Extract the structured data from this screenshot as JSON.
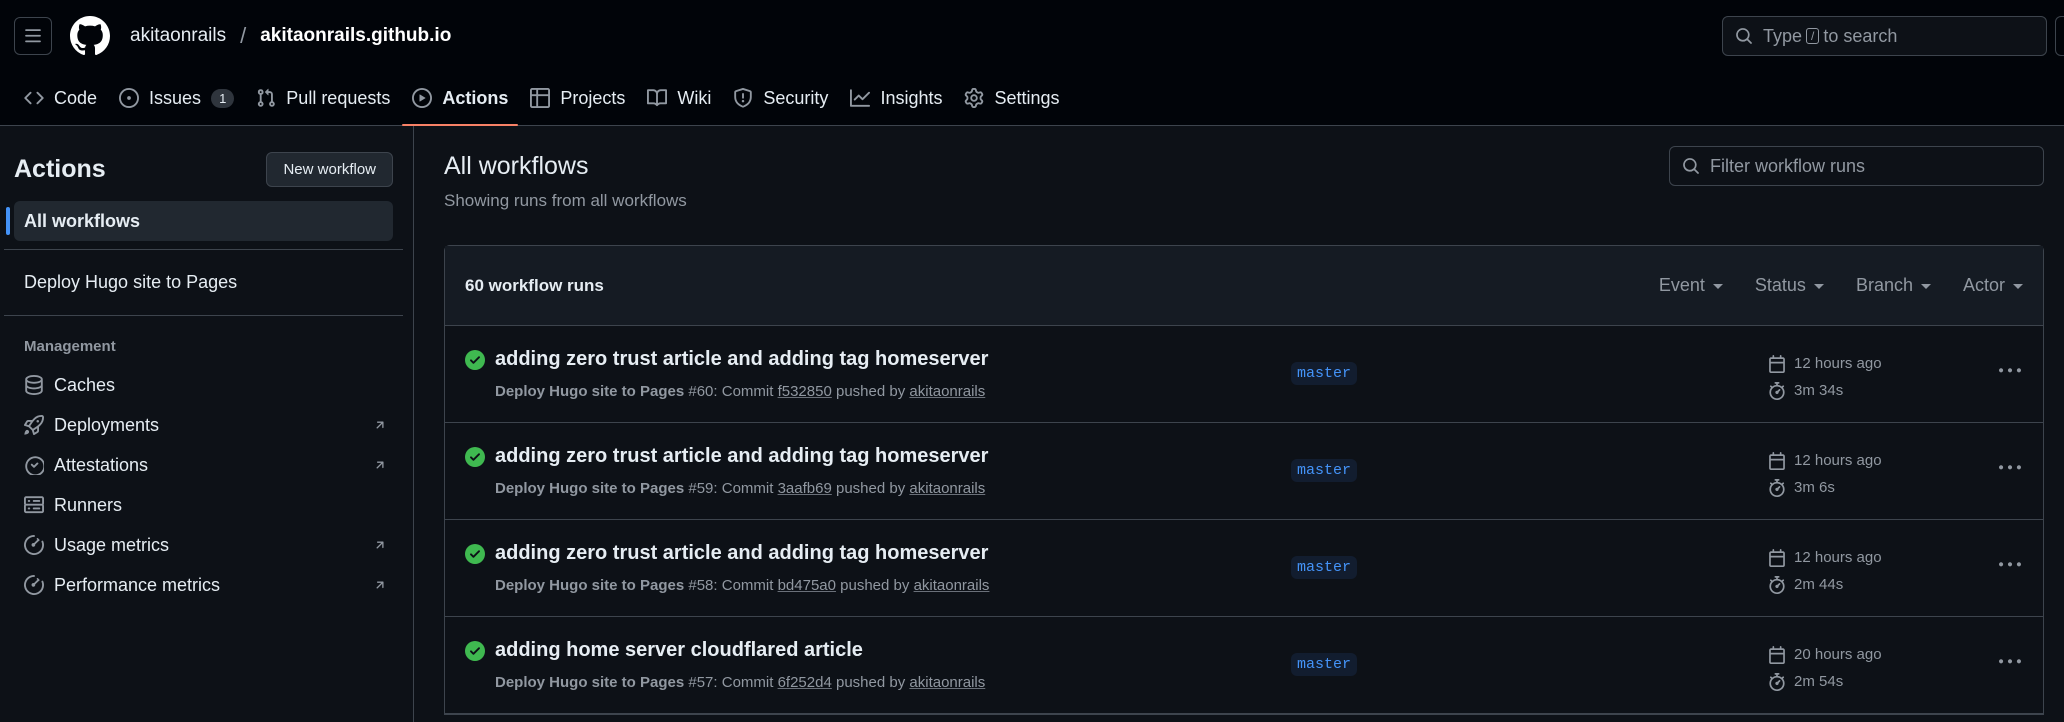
{
  "header": {
    "owner": "akitaonrails",
    "separator": "/",
    "repo": "akitaonrails.github.io",
    "search_prefix": "Type",
    "search_key": "/",
    "search_suffix": "to search"
  },
  "nav": {
    "code": "Code",
    "issues": "Issues",
    "issues_count": "1",
    "pulls": "Pull requests",
    "actions": "Actions",
    "projects": "Projects",
    "wiki": "Wiki",
    "security": "Security",
    "insights": "Insights",
    "settings": "Settings"
  },
  "sidebar": {
    "title": "Actions",
    "new_workflow": "New workflow",
    "all_workflows": "All workflows",
    "workflow": "Deploy Hugo site to Pages",
    "management": "Management",
    "items": {
      "caches": "Caches",
      "deployments": "Deployments",
      "attestations": "Attestations",
      "runners": "Runners",
      "usage": "Usage metrics",
      "performance": "Performance metrics"
    }
  },
  "main": {
    "title": "All workflows",
    "subtitle": "Showing runs from all workflows",
    "filter_placeholder": "Filter workflow runs",
    "runs_count": "60 workflow runs",
    "filters": {
      "event": "Event",
      "status": "Status",
      "branch": "Branch",
      "actor": "Actor"
    },
    "runs": [
      {
        "title": "adding zero trust article and adding tag homeserver",
        "workflow": "Deploy Hugo site to Pages",
        "number": "#60: Commit",
        "commit": "f532850",
        "pushed_by": "pushed by",
        "actor": "akitaonrails",
        "branch": "master",
        "when": "12 hours ago",
        "duration": "3m 34s"
      },
      {
        "title": "adding zero trust article and adding tag homeserver",
        "workflow": "Deploy Hugo site to Pages",
        "number": "#59: Commit",
        "commit": "3aafb69",
        "pushed_by": "pushed by",
        "actor": "akitaonrails",
        "branch": "master",
        "when": "12 hours ago",
        "duration": "3m 6s"
      },
      {
        "title": "adding zero trust article and adding tag homeserver",
        "workflow": "Deploy Hugo site to Pages",
        "number": "#58: Commit",
        "commit": "bd475a0",
        "pushed_by": "pushed by",
        "actor": "akitaonrails",
        "branch": "master",
        "when": "12 hours ago",
        "duration": "2m 44s"
      },
      {
        "title": "adding home server cloudflared article",
        "workflow": "Deploy Hugo site to Pages",
        "number": "#57: Commit",
        "commit": "6f252d4",
        "pushed_by": "pushed by",
        "actor": "akitaonrails",
        "branch": "master",
        "when": "20 hours ago",
        "duration": "2m 54s"
      }
    ]
  },
  "colors": {
    "background": "#0d1117",
    "header": "#010409",
    "accent": "#4493f8",
    "success": "#3fb950",
    "active_tab": "#f78166"
  }
}
